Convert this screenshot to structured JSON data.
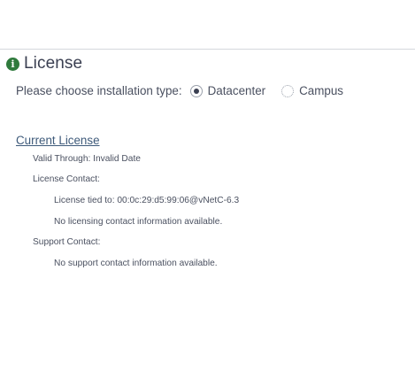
{
  "section": {
    "title": "License",
    "icon": "info-icon"
  },
  "install": {
    "label": "Please choose installation type:",
    "options": [
      {
        "label": "Datacenter",
        "selected": true
      },
      {
        "label": "Campus",
        "selected": false
      }
    ]
  },
  "current_license": {
    "heading": "Current License",
    "valid_through": "Valid Through: Invalid Date",
    "license_contact_label": "License Contact:",
    "license_tied_to": "License tied to: 00:0c:29:d5:99:06@vNetC-6.3",
    "license_contact_info": "No licensing contact information available.",
    "support_contact_label": "Support Contact:",
    "support_contact_info": "No support contact information available."
  },
  "colors": {
    "accent_green": "#2f7a3c",
    "link_blue": "#3e5a7a",
    "text": "#4a5060"
  }
}
